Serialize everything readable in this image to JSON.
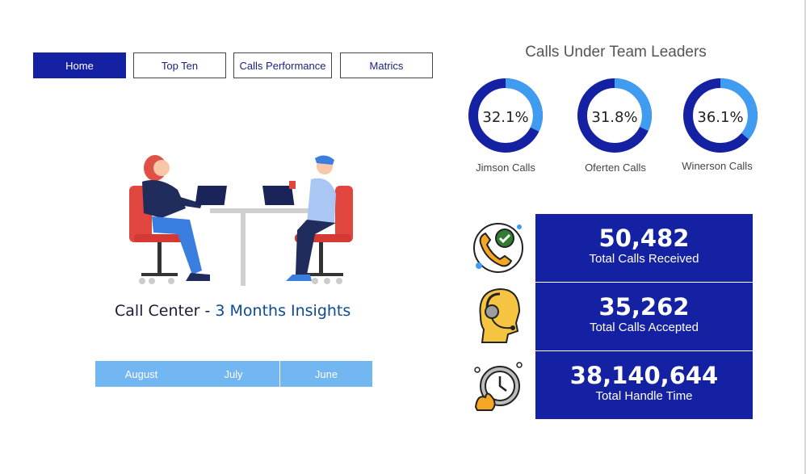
{
  "nav": {
    "items": [
      {
        "label": "Home",
        "active": true
      },
      {
        "label": "Top Ten",
        "active": false
      },
      {
        "label": "Calls Performance",
        "active": false
      },
      {
        "label": "Matrics",
        "active": false
      }
    ]
  },
  "hero": {
    "title_prefix": "Call Center - ",
    "title_accent": "3 Months Insights"
  },
  "months": [
    "August",
    "July",
    "June"
  ],
  "leaders": {
    "title": "Calls Under Team Leaders",
    "items": [
      {
        "percent": 32.1,
        "label_value": "32.1%",
        "name": "Jimson Calls"
      },
      {
        "percent": 31.8,
        "label_value": "31.8%",
        "name": "Oferten Calls"
      },
      {
        "percent": 36.1,
        "label_value": "36.1%",
        "name": "Winerson Calls"
      }
    ]
  },
  "kpis": [
    {
      "value": "50,482",
      "label": "Total Calls Received",
      "icon": "phone-check-icon"
    },
    {
      "value": "35,262",
      "label": "Total Calls Accepted",
      "icon": "headset-agent-icon"
    },
    {
      "value": "38,140,644",
      "label": "Total Handle Time",
      "icon": "clock-icon"
    }
  ],
  "colors": {
    "brand": "#1521a3",
    "donut_primary": "#1521a3",
    "donut_secondary": "#3f9cf0",
    "month_bar": "#72b7f2",
    "title_accent": "#0e4a8f"
  }
}
